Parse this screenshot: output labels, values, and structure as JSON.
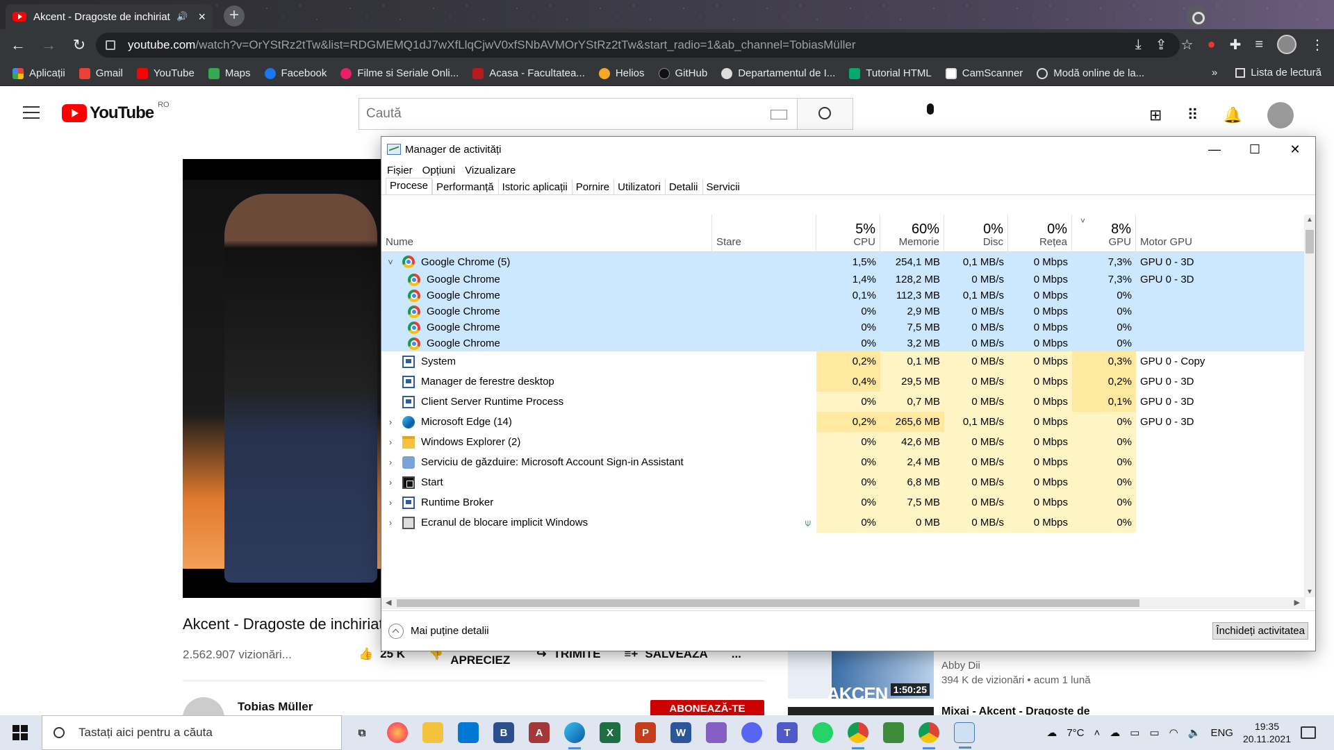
{
  "browser": {
    "tab_title": "Akcent - Dragoste de inchiriat",
    "url_host": "youtube.com",
    "url_path": "/watch?v=OrYStRz2tTw&list=RDGMEMQ1dJ7wXfLlqCjwV0xfSNbAVMOrYStRz2tTw&start_radio=1&ab_channel=TobiasMüller",
    "bookmarks": [
      "Aplicații",
      "Gmail",
      "YouTube",
      "Maps",
      "Facebook",
      "Filme si Seriale Onli...",
      "Acasa - Facultatea...",
      "Helios",
      "GitHub",
      "Departamentul de I...",
      "Tutorial HTML",
      "CamScanner",
      "Modă online de la..."
    ],
    "bookmark_overflow": "»",
    "reading_list": "Lista de lectură"
  },
  "youtube": {
    "logo_text": "YouTube",
    "country": "RO",
    "search_placeholder": "Caută",
    "video_title": "Akcent - Dragoste de inchiriat",
    "views": "2.562.907 vizionări...",
    "likes": "25 K",
    "dislike": "NU APRECIEZ",
    "share": "TRIMITE",
    "save": "SALVEAZĂ",
    "more": "...",
    "channel": "Tobias Müller",
    "subscribe": "ABONEAZĂ-TE",
    "side_label": "AKCEN",
    "side_duration": "1:50:25",
    "side_channel": "Abby Dii",
    "side_meta": "394 K de vizionări • acum 1 lună",
    "side_title2": "Mixai - Akcent - Dragoste de"
  },
  "taskmanager": {
    "title": "Manager de activități",
    "menu": [
      "Fișier",
      "Opțiuni",
      "Vizualizare"
    ],
    "tabs": [
      "Procese",
      "Performanță",
      "Istoric aplicații",
      "Pornire",
      "Utilizatori",
      "Detalii",
      "Servicii"
    ],
    "headers": {
      "name": "Nume",
      "status": "Stare",
      "cpu_pct": "5%",
      "cpu": "CPU",
      "mem_pct": "60%",
      "mem": "Memorie",
      "disk_pct": "0%",
      "disk": "Disc",
      "net_pct": "0%",
      "net": "Rețea",
      "gpu_pct": "8%",
      "gpu": "GPU",
      "engine": "Motor GPU",
      "sort_arrow": "˅"
    },
    "rows": [
      {
        "name": "Google Chrome (5)",
        "cpu": "1,5%",
        "mem": "254,1 MB",
        "disk": "0,1 MB/s",
        "net": "0 Mbps",
        "gpu": "7,3%",
        "engine": "GPU 0 - 3D",
        "expander": "˅",
        "icon": "chrome"
      },
      {
        "name": "Google Chrome",
        "cpu": "1,4%",
        "mem": "128,2 MB",
        "disk": "0 MB/s",
        "net": "0 Mbps",
        "gpu": "7,3%",
        "engine": "GPU 0 - 3D",
        "icon": "chrome"
      },
      {
        "name": "Google Chrome",
        "cpu": "0,1%",
        "mem": "112,3 MB",
        "disk": "0,1 MB/s",
        "net": "0 Mbps",
        "gpu": "0%",
        "engine": "",
        "icon": "chrome"
      },
      {
        "name": "Google Chrome",
        "cpu": "0%",
        "mem": "2,9 MB",
        "disk": "0 MB/s",
        "net": "0 Mbps",
        "gpu": "0%",
        "engine": "",
        "icon": "chrome"
      },
      {
        "name": "Google Chrome",
        "cpu": "0%",
        "mem": "7,5 MB",
        "disk": "0 MB/s",
        "net": "0 Mbps",
        "gpu": "0%",
        "engine": "",
        "icon": "chrome"
      },
      {
        "name": "Google Chrome",
        "cpu": "0%",
        "mem": "3,2 MB",
        "disk": "0 MB/s",
        "net": "0 Mbps",
        "gpu": "0%",
        "engine": "",
        "icon": "chrome"
      },
      {
        "name": "System",
        "cpu": "0,2%",
        "mem": "0,1 MB",
        "disk": "0 MB/s",
        "net": "0 Mbps",
        "gpu": "0,3%",
        "engine": "GPU 0 - Copy",
        "icon": "system"
      },
      {
        "name": "Manager de ferestre desktop",
        "cpu": "0,4%",
        "mem": "29,5 MB",
        "disk": "0 MB/s",
        "net": "0 Mbps",
        "gpu": "0,2%",
        "engine": "GPU 0 - 3D",
        "icon": "system"
      },
      {
        "name": "Client Server Runtime Process",
        "cpu": "0%",
        "mem": "0,7 MB",
        "disk": "0 MB/s",
        "net": "0 Mbps",
        "gpu": "0,1%",
        "engine": "GPU 0 - 3D",
        "icon": "system"
      },
      {
        "name": "Microsoft Edge (14)",
        "cpu": "0,2%",
        "mem": "265,6 MB",
        "disk": "0,1 MB/s",
        "net": "0 Mbps",
        "gpu": "0%",
        "engine": "GPU 0 - 3D",
        "expander": "›",
        "icon": "edge"
      },
      {
        "name": "Windows Explorer (2)",
        "cpu": "0%",
        "mem": "42,6 MB",
        "disk": "0 MB/s",
        "net": "0 Mbps",
        "gpu": "0%",
        "engine": "",
        "expander": "›",
        "icon": "explorer"
      },
      {
        "name": "Serviciu de găzduire: Microsoft Account Sign-in Assistant",
        "cpu": "0%",
        "mem": "2,4 MB",
        "disk": "0 MB/s",
        "net": "0 Mbps",
        "gpu": "0%",
        "engine": "",
        "expander": "›",
        "icon": "service"
      },
      {
        "name": "Start",
        "cpu": "0%",
        "mem": "6,8 MB",
        "disk": "0 MB/s",
        "net": "0 Mbps",
        "gpu": "0%",
        "engine": "",
        "expander": "›",
        "icon": "start"
      },
      {
        "name": "Runtime Broker",
        "cpu": "0%",
        "mem": "7,5 MB",
        "disk": "0 MB/s",
        "net": "0 Mbps",
        "gpu": "0%",
        "engine": "",
        "expander": "›",
        "icon": "system"
      },
      {
        "name": "Ecranul de blocare implicit Windows",
        "cpu": "0%",
        "mem": "0 MB",
        "disk": "0 MB/s",
        "net": "0 Mbps",
        "gpu": "0%",
        "engine": "",
        "expander": "›",
        "icon": "lock",
        "status_icon": "leaf-icon"
      }
    ],
    "fewer_details": "Mai puține detalii",
    "end_task": "Închideți activitatea"
  },
  "taskbar": {
    "search_placeholder": "Tastați aici pentru a căuta",
    "weather": "7°C",
    "language": "ENG",
    "time": "19:35",
    "date": "20.11.2021"
  },
  "colors": {
    "selected_row": "#cce8ff",
    "heat_light": "#fff4c4",
    "heat_medium": "#ffe9a0",
    "yt_red": "#ff0000"
  }
}
